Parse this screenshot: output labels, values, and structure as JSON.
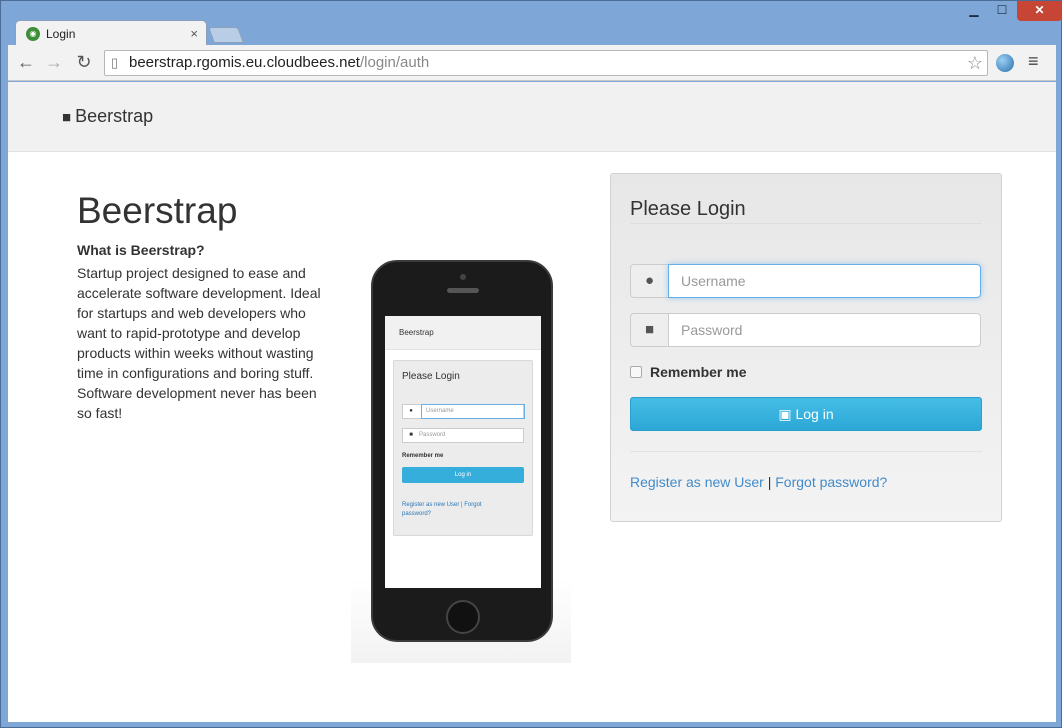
{
  "browser": {
    "tab_title": "Login",
    "url_host": "beerstrap.rgomis.eu.cloudbees.net",
    "url_path": "/login/auth",
    "close_tab": "×",
    "window_min": "▁",
    "window_max": "☐",
    "window_close": "✕"
  },
  "navbar": {
    "brand": "Beerstrap"
  },
  "hero": {
    "title": "Beerstrap",
    "subtitle": "What is Beerstrap?",
    "description": "Startup project designed to ease and accelerate software development. Ideal for startups and web developers who want to rapid-prototype and develop products within weeks without wasting time in configurations and boring stuff. Software development never has been so fast!"
  },
  "phone_screen": {
    "brand": "Beerstrap",
    "heading": "Please Login",
    "username_placeholder": "Username",
    "password_placeholder": "Password",
    "remember": "Remember me",
    "login": "Log in",
    "links": "Register as new User | Forgot password?"
  },
  "login": {
    "title": "Please Login",
    "username_placeholder": "Username",
    "password_placeholder": "Password",
    "remember_label": "Remember me",
    "button_label": "Log in",
    "register_link": "Register as new User",
    "separator": "|",
    "forgot_link": "Forgot password?"
  },
  "colors": {
    "primary_button": "#35aedb",
    "link": "#428bca"
  }
}
